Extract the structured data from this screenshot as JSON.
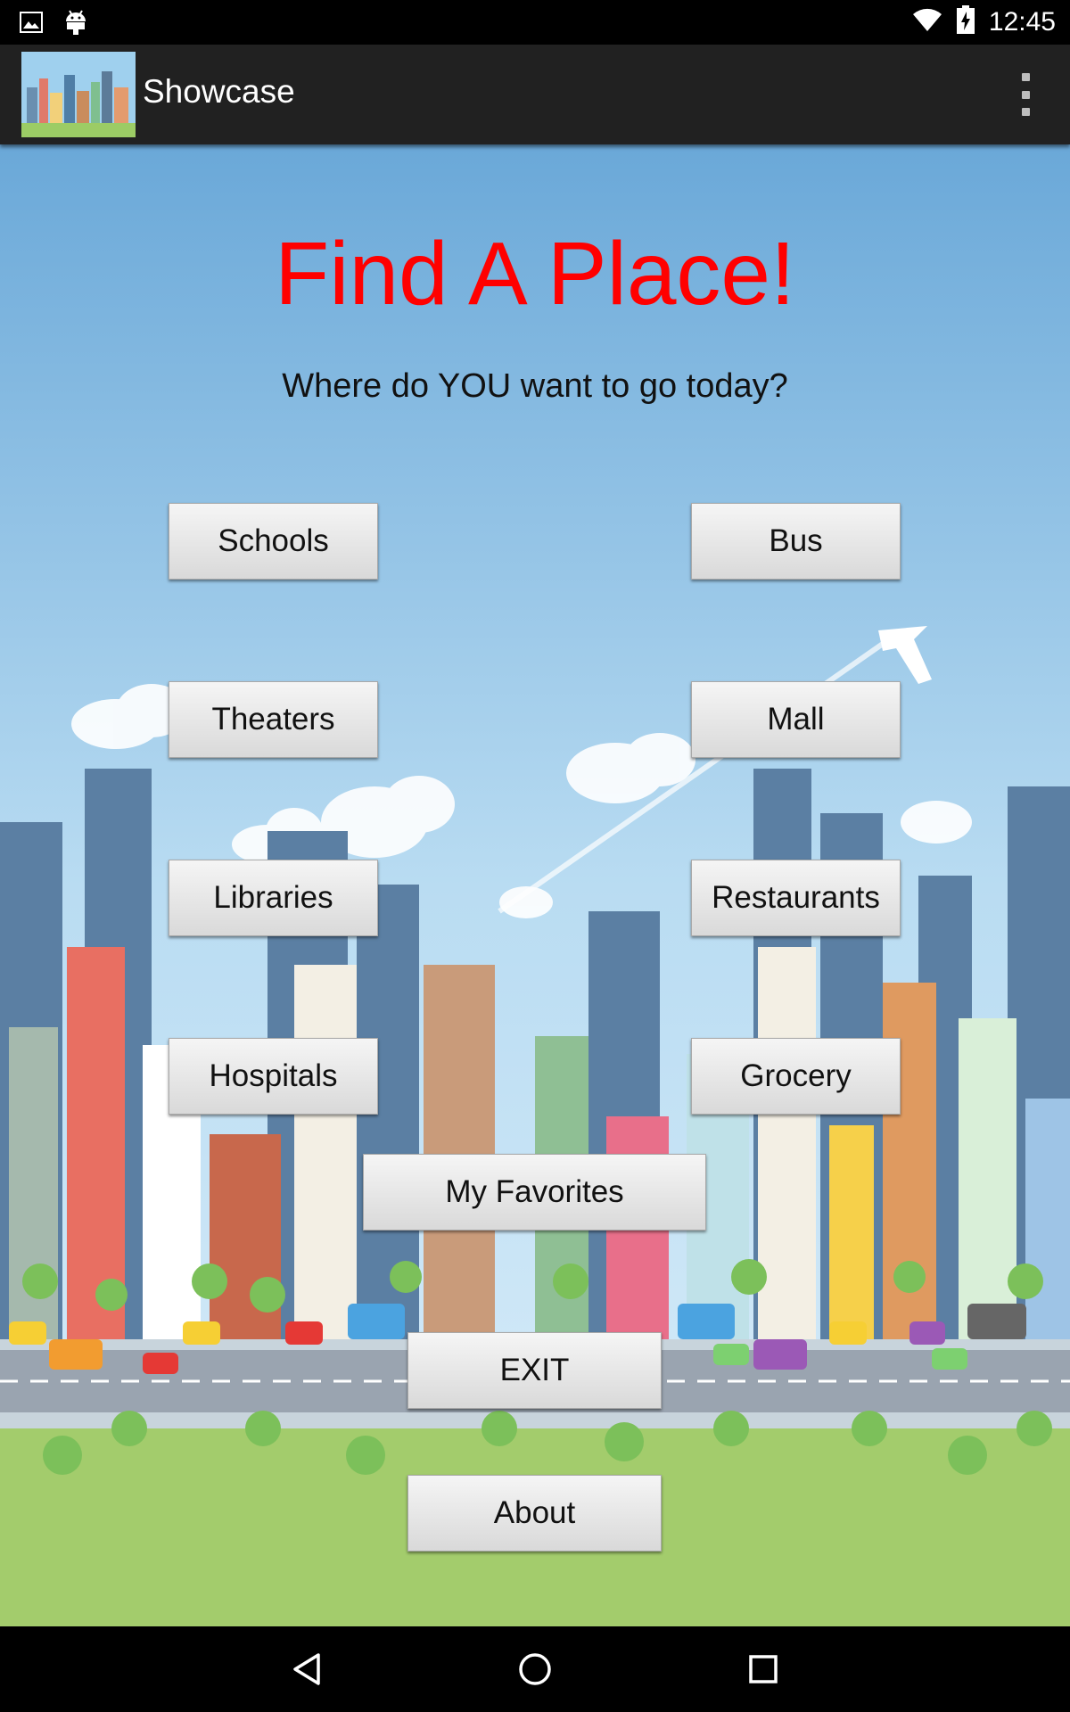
{
  "status_bar": {
    "time": "12:45",
    "icons": [
      "image-icon",
      "android-icon",
      "wifi-icon",
      "battery-charging-icon"
    ]
  },
  "action_bar": {
    "title": "Showcase",
    "icon": "city-thumbnail-icon",
    "overflow": "overflow-menu-icon"
  },
  "main": {
    "title": "Find A Place!",
    "subtitle": "Where do YOU want to go today?",
    "title_color": "#ff0000"
  },
  "buttons": {
    "schools": "Schools",
    "bus": "Bus",
    "theaters": "Theaters",
    "mall": "Mall",
    "libraries": "Libraries",
    "restaurants": "Restaurants",
    "hospitals": "Hospitals",
    "grocery": "Grocery",
    "favorites": "My Favorites",
    "exit": "EXIT",
    "about": "About"
  },
  "nav_bar": {
    "back": "back-icon",
    "home": "home-icon",
    "recents": "recents-icon"
  }
}
